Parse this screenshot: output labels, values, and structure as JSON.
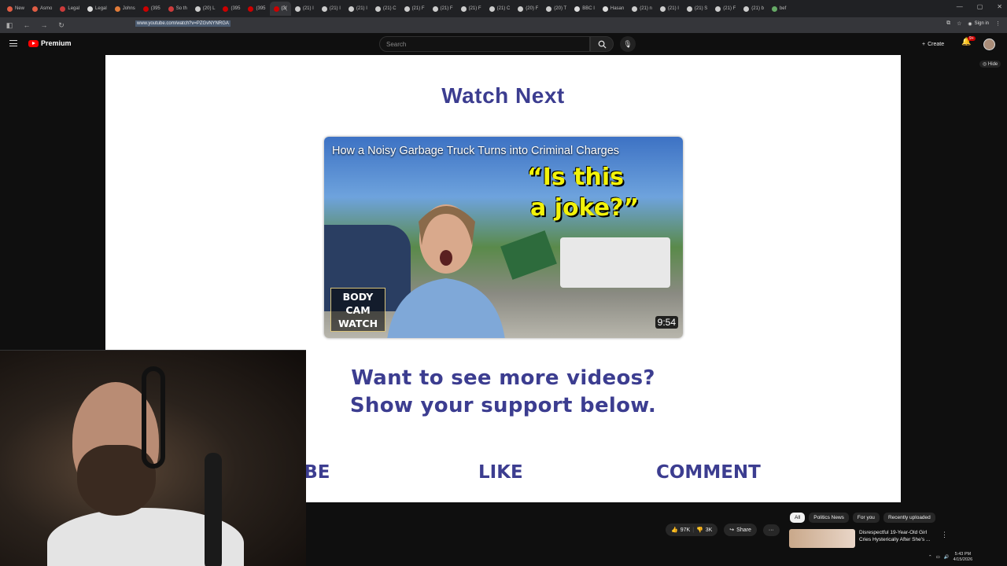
{
  "browser": {
    "tabs": [
      {
        "label": "New",
        "color": "#e05d44"
      },
      {
        "label": "Asmo",
        "color": "#e05d44"
      },
      {
        "label": "Legal",
        "color": "#cc3b3b"
      },
      {
        "label": "Legal",
        "color": "#dddddd"
      },
      {
        "label": "Johns",
        "color": "#e07b39"
      },
      {
        "label": "(395",
        "color": "#cc0000"
      },
      {
        "label": "So th",
        "color": "#cc3b3b"
      },
      {
        "label": "(20) L",
        "color": "#cccccc"
      },
      {
        "label": "(395",
        "color": "#cc0000"
      },
      {
        "label": "(395",
        "color": "#cc0000"
      },
      {
        "label": "(3(",
        "color": "#cc0000",
        "active": true
      },
      {
        "label": "(21) I",
        "color": "#cccccc"
      },
      {
        "label": "(21) I",
        "color": "#cccccc"
      },
      {
        "label": "(21) I",
        "color": "#cccccc"
      },
      {
        "label": "(21) C",
        "color": "#cccccc"
      },
      {
        "label": "(21) F",
        "color": "#cccccc"
      },
      {
        "label": "(21) F",
        "color": "#cccccc"
      },
      {
        "label": "(21) F",
        "color": "#cccccc"
      },
      {
        "label": "(21) C",
        "color": "#cccccc"
      },
      {
        "label": "(20) F",
        "color": "#cccccc"
      },
      {
        "label": "(20) T",
        "color": "#cccccc"
      },
      {
        "label": "BBC I",
        "color": "#dddddd"
      },
      {
        "label": "Hasan",
        "color": "#dddddd"
      },
      {
        "label": "(21) n",
        "color": "#cccccc"
      },
      {
        "label": "(21) I",
        "color": "#cccccc"
      },
      {
        "label": "(21) S",
        "color": "#cccccc"
      },
      {
        "label": "(21) F",
        "color": "#cccccc"
      },
      {
        "label": "(21) b",
        "color": "#cccccc"
      },
      {
        "label": "bef",
        "color": "#66aa66"
      }
    ],
    "url": "www.youtube.com/watch?v=PZGvNYNRGA",
    "sign_in": "Sign in"
  },
  "youtube": {
    "logo_text": "Premium",
    "search_placeholder": "Search",
    "create_label": "Create",
    "notif_badge": "9+",
    "hide_label": "Hide",
    "actions": {
      "likes": "97K",
      "dislikes": "3K",
      "share": "Share"
    },
    "chips": [
      "All",
      "Politics News",
      "For you",
      "Recently uploaded"
    ],
    "recommendation": {
      "title": "Disrespectful 19-Year-Old Girl Cries Hysterically After She's ..."
    }
  },
  "video": {
    "heading": "Watch Next",
    "thumbnail": {
      "title": "How a Noisy Garbage Truck Turns into Criminal Charges",
      "quote_line1": "“Is this",
      "quote_line2": "a joke?”",
      "badge_lines": [
        "BODY",
        "CAM",
        "WATCH"
      ],
      "duration": "9:54"
    },
    "support_line1": "Want to see more videos?",
    "support_line2": "Show your support below.",
    "cta": {
      "subscribe": "RIBE",
      "like": "LIKE",
      "comment": "COMMENT"
    }
  },
  "taskbar": {
    "time": "5:43 PM",
    "date": "4/15/2026"
  },
  "colors": {
    "accent_text": "#3c3d90",
    "quote": "#f2f20a",
    "yt_red": "#ff0000"
  }
}
